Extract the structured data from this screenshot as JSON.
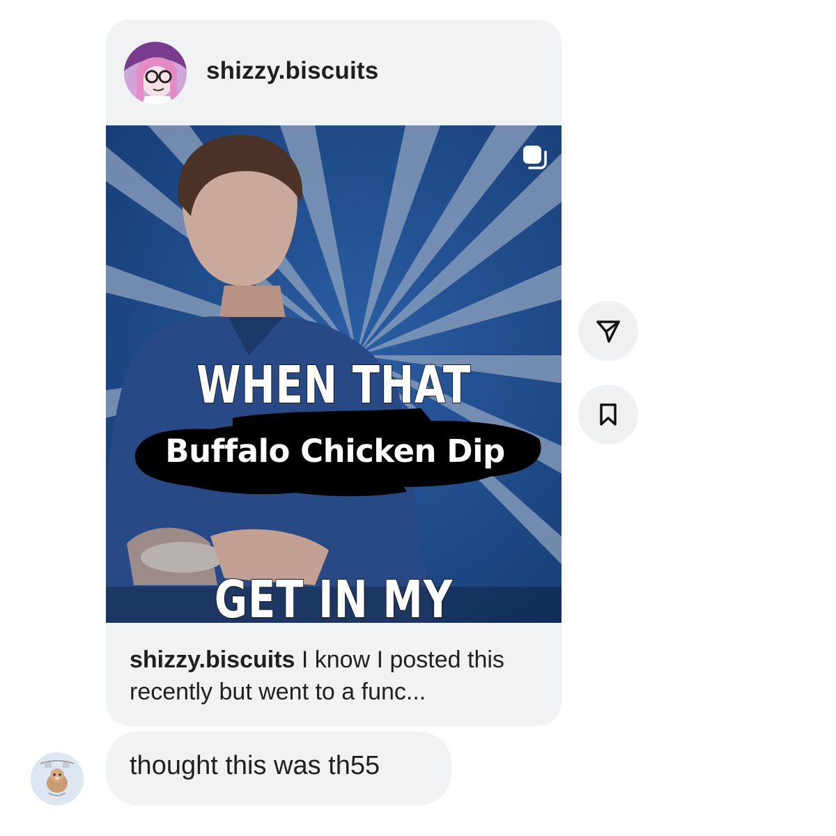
{
  "post": {
    "author": "shizzy.biscuits",
    "media": {
      "top_text": "WHEN THAT",
      "sticker_text": "Buffalo Chicken Dip",
      "bottom_text": "GET IN MY SYSTEM",
      "multi_icon": "carousel-icon"
    },
    "caption": {
      "author": "shizzy.biscuits",
      "text": " I know I posted this recently but went to a func..."
    }
  },
  "actions": {
    "share_icon": "send-icon",
    "save_icon": "bookmark-icon"
  },
  "reply": {
    "text": "thought this was th55"
  },
  "colors": {
    "bubble": "#f1f2f4",
    "text": "#1f1f1f",
    "media_blue": "#1d4a8a"
  }
}
